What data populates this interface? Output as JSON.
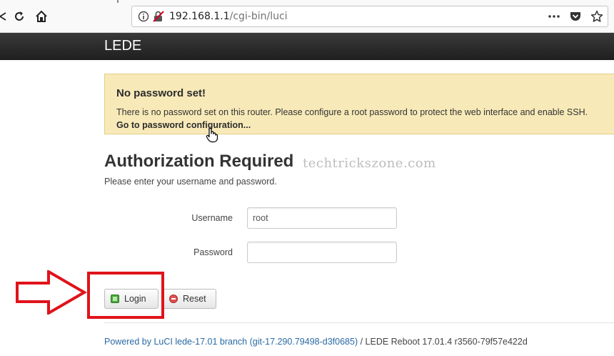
{
  "browser": {
    "url_host": "192.168.1.1",
    "url_path": "/cgi-bin/luci",
    "more_icon": "ellipsis-icon",
    "pocket_icon": "pocket-icon",
    "bookmark_icon": "star-icon"
  },
  "header": {
    "brand": "LEDE"
  },
  "alert": {
    "title": "No password set!",
    "message": "There is no password set on this router. Please configure a root password to protect the web interface and enable SSH.",
    "link": "Go to password configuration..."
  },
  "auth": {
    "title": "Authorization Required",
    "watermark": "techtrickszone.com",
    "description": "Please enter your username and password.",
    "username_label": "Username",
    "username_value": "root",
    "password_label": "Password",
    "password_value": ""
  },
  "buttons": {
    "login": "Login",
    "reset": "Reset"
  },
  "footer": {
    "link": "Powered by LuCI lede-17.01 branch (git-17.290.79498-d3f0685)",
    "text": " / LEDE Reboot 17.01.4 r3560-79f57e422d"
  },
  "colors": {
    "alert_bg": "#f8eab8",
    "header_bg": "#1f1f1f",
    "annotation_red": "#e0131a",
    "link": "#2a6aa5"
  }
}
